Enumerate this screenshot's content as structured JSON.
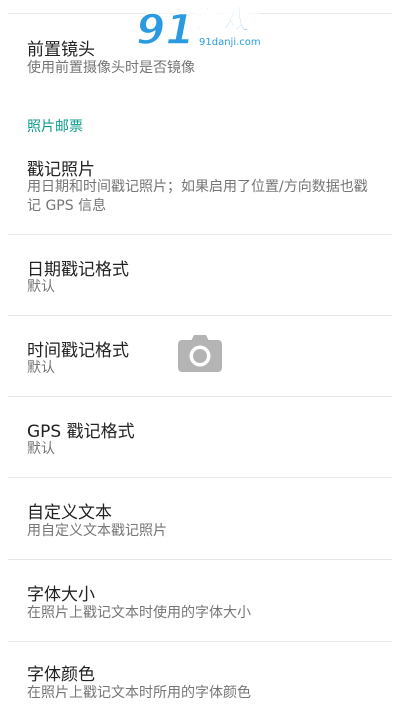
{
  "settings": {
    "front_camera": {
      "title": "前置镜头",
      "summary": "使用前置摄像头时是否镜像"
    },
    "category_label": "照片邮票",
    "stamp_photos": {
      "title": "戳记照片",
      "summary": "用日期和时间戳记照片；如果启用了位置/方向数据也戳记 GPS 信息"
    },
    "date_format": {
      "title": "日期戳记格式",
      "summary": "默认"
    },
    "time_format": {
      "title": "时间戳记格式",
      "summary": "默认"
    },
    "gps_format": {
      "title": "GPS 戳记格式",
      "summary": "默认"
    },
    "custom_text": {
      "title": "自定义文本",
      "summary": "用自定义文本戳记照片"
    },
    "font_size": {
      "title": "字体大小",
      "summary": "在照片上戳记文本时使用的字体大小"
    },
    "font_color": {
      "title": "字体颜色",
      "summary": "在照片上戳记文本时所用的字体颜色"
    }
  },
  "watermark": {
    "logo_text": "游戏",
    "number": "91",
    "site": "91danji.com"
  },
  "icons": {
    "overlay": "camera-icon"
  },
  "colors": {
    "accent": "#0a9a8a",
    "title": "#222222",
    "summary": "#757575",
    "divider": "#e6e6e6"
  }
}
